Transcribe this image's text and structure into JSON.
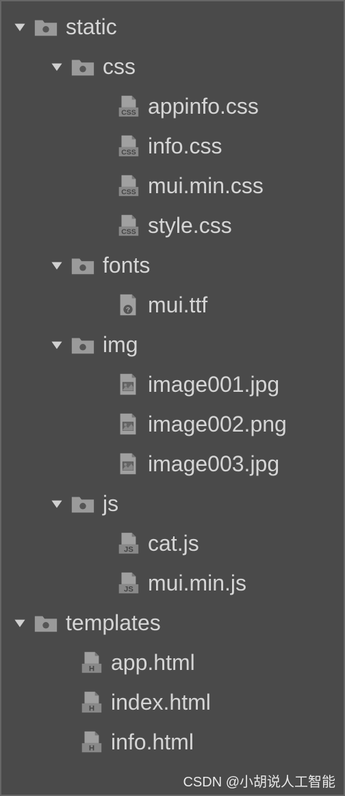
{
  "tree": [
    {
      "indent": 0,
      "type": "folder",
      "label": "static",
      "expanded": true
    },
    {
      "indent": 1,
      "type": "folder",
      "label": "css",
      "expanded": true
    },
    {
      "indent": 2,
      "type": "css",
      "label": "appinfo.css"
    },
    {
      "indent": 2,
      "type": "css",
      "label": "info.css"
    },
    {
      "indent": 2,
      "type": "css",
      "label": "mui.min.css"
    },
    {
      "indent": 2,
      "type": "css",
      "label": "style.css"
    },
    {
      "indent": 1,
      "type": "folder",
      "label": "fonts",
      "expanded": true
    },
    {
      "indent": 2,
      "type": "font",
      "label": "mui.ttf"
    },
    {
      "indent": 1,
      "type": "folder",
      "label": "img",
      "expanded": true
    },
    {
      "indent": 2,
      "type": "image",
      "label": "image001.jpg"
    },
    {
      "indent": 2,
      "type": "image",
      "label": "image002.png"
    },
    {
      "indent": 2,
      "type": "image",
      "label": "image003.jpg"
    },
    {
      "indent": 1,
      "type": "folder",
      "label": "js",
      "expanded": true
    },
    {
      "indent": 2,
      "type": "js",
      "label": "cat.js"
    },
    {
      "indent": 2,
      "type": "js",
      "label": "mui.min.js"
    },
    {
      "indent": 0,
      "type": "folder",
      "label": "templates",
      "expanded": true
    },
    {
      "indent": 1,
      "type": "html",
      "label": "app.html"
    },
    {
      "indent": 1,
      "type": "html",
      "label": "index.html"
    },
    {
      "indent": 1,
      "type": "html",
      "label": "info.html"
    }
  ],
  "watermark": "CSDN @小胡说人工智能"
}
